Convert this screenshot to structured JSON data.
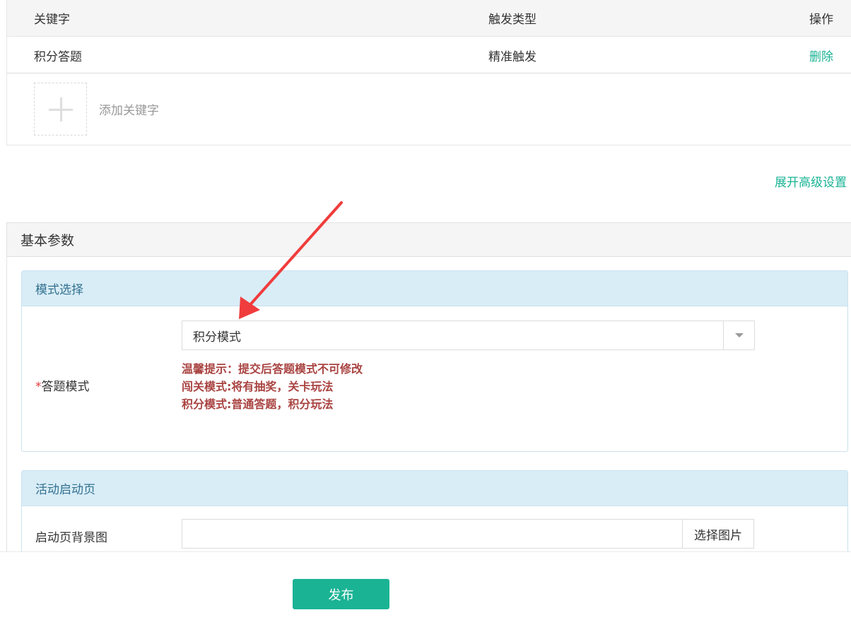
{
  "keywords": {
    "columns": {
      "keyword": "关键字",
      "trigger_type": "触发类型",
      "action": "操作"
    },
    "rows": [
      {
        "keyword": "积分答题",
        "trigger_type": "精准触发",
        "action": "删除"
      }
    ],
    "add_label": "添加关键字"
  },
  "advanced_link": "展开高级设置",
  "basic": {
    "title": "基本参数",
    "mode_section": {
      "title": "模式选择",
      "required_mark": "*",
      "label": "答题模式",
      "selected": "积分模式",
      "tips": [
        "温馨提示：提交后答题模式不可修改",
        "闯关模式:将有抽奖，关卡玩法",
        "积分模式:普通答题，积分玩法"
      ]
    },
    "launch_section": {
      "title": "活动启动页",
      "bg_label": "启动页背景图",
      "bg_value": "",
      "pick_button": "选择图片"
    }
  },
  "footer": {
    "publish": "发布"
  },
  "colors": {
    "accent": "#1ab394",
    "warning_text": "#a94442",
    "section_header_bg": "#d9edf7",
    "annotation_arrow": "#f03c3c"
  },
  "icons": {
    "add": "plus-icon",
    "dropdown": "caret-down-icon",
    "annotation": "red-arrow-annotation"
  }
}
